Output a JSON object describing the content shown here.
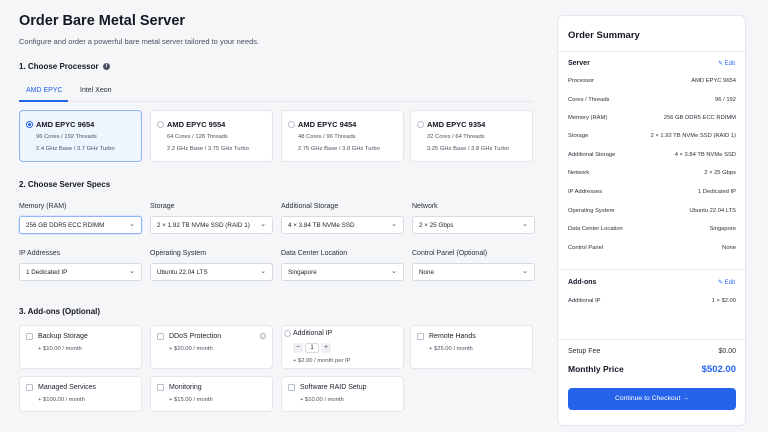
{
  "page": {
    "title": "Order Bare Metal Server",
    "subtitle": "Configure and order a powerful bare metal server tailored to your needs."
  },
  "sections": {
    "processor": "1. Choose Processor",
    "specs": "2. Choose Server Specs",
    "addons": "3. Add-ons (Optional)"
  },
  "tabs": [
    {
      "label": "AMD EPYC",
      "active": true
    },
    {
      "label": "Intel Xeon",
      "active": false
    }
  ],
  "processors": [
    {
      "name": "AMD EPYC 9654",
      "cores": "96 Cores / 192 Threads",
      "ghz": "2.4 GHz Base / 3.7 GHz Turbo",
      "selected": true
    },
    {
      "name": "AMD EPYC 9554",
      "cores": "64 Cores / 128 Threads",
      "ghz": "2.2 GHz Base / 3.75 GHz Turbo",
      "selected": false
    },
    {
      "name": "AMD EPYC 9454",
      "cores": "48 Cores / 96 Threads",
      "ghz": "2.75 GHz Base / 3.8 GHz Turbo",
      "selected": false
    },
    {
      "name": "AMD EPYC 9354",
      "cores": "32 Cores / 64 Threads",
      "ghz": "3.25 GHz Base / 3.8 GHz Turbo",
      "selected": false
    }
  ],
  "specs": [
    {
      "label": "Memory (RAM)",
      "value": "256 GB DDR5 ECC RDIMM"
    },
    {
      "label": "Storage",
      "value": "2 × 1.92 TB NVMe SSD (RAID 1)"
    },
    {
      "label": "Additional Storage",
      "value": "4 × 3.84 TB NVMe SSD"
    },
    {
      "label": "Network",
      "value": "2 × 25 Gbps"
    },
    {
      "label": "IP Addresses",
      "value": "1 Dedicated IP"
    },
    {
      "label": "Operating System",
      "value": "Ubuntu 22.04 LTS"
    },
    {
      "label": "Data Center Location",
      "value": "Singapore"
    },
    {
      "label": "Control Panel (Optional)",
      "value": "None"
    }
  ],
  "addons": [
    {
      "name": "Backup Storage",
      "price": "+ $10.00 / month"
    },
    {
      "name": "DDoS Protection",
      "price": "+ $20.00 / month"
    },
    {
      "name": "Additional IP",
      "price": "+ $2.00 / month per IP",
      "quantity": "1"
    },
    {
      "name": "Remote Hands",
      "price": "+ $25.00 / month"
    },
    {
      "name": "Managed Services",
      "price": "+ $100.00 / month"
    },
    {
      "name": "Monitoring",
      "price": "+ $15.00 / month"
    },
    {
      "name": "Software RAID Setup",
      "price": "+ $10.00 / month"
    }
  ],
  "summary": {
    "title": "Order Summary",
    "server_heading": "Server",
    "edit_label": "Edit",
    "rows": [
      {
        "k": "Processor",
        "v": "AMD EPYC 9654"
      },
      {
        "k": "Cores / Threads",
        "v": "96 / 192"
      },
      {
        "k": "Memory (RAM)",
        "v": "256 GB DDR5 ECC RDIMM"
      },
      {
        "k": "Storage",
        "v": "2 × 1.92 TB NVMe SSD (RAID 1)"
      },
      {
        "k": "Additional Storage",
        "v": "4 × 3.84 TB NVMe SSD"
      },
      {
        "k": "Network",
        "v": "2 × 25 Gbps"
      },
      {
        "k": "IP Addresses",
        "v": "1 Dedicated IP"
      },
      {
        "k": "Operating System",
        "v": "Ubuntu 22.04 LTS"
      },
      {
        "k": "Data Center Location",
        "v": "Singapore"
      },
      {
        "k": "Control Panel",
        "v": "None"
      }
    ],
    "addons_heading": "Add-ons",
    "addon_rows": [
      {
        "k": "Additional IP",
        "v": "1 × $2.00"
      }
    ],
    "setup_fee_label": "Setup Fee",
    "setup_fee": "$0.00",
    "monthly_label": "Monthly Price",
    "monthly_price": "$502.00",
    "checkout_label": "Continue to Checkout →"
  },
  "colors": {
    "accent": "#2563eb",
    "background": "#f5f6f8"
  }
}
